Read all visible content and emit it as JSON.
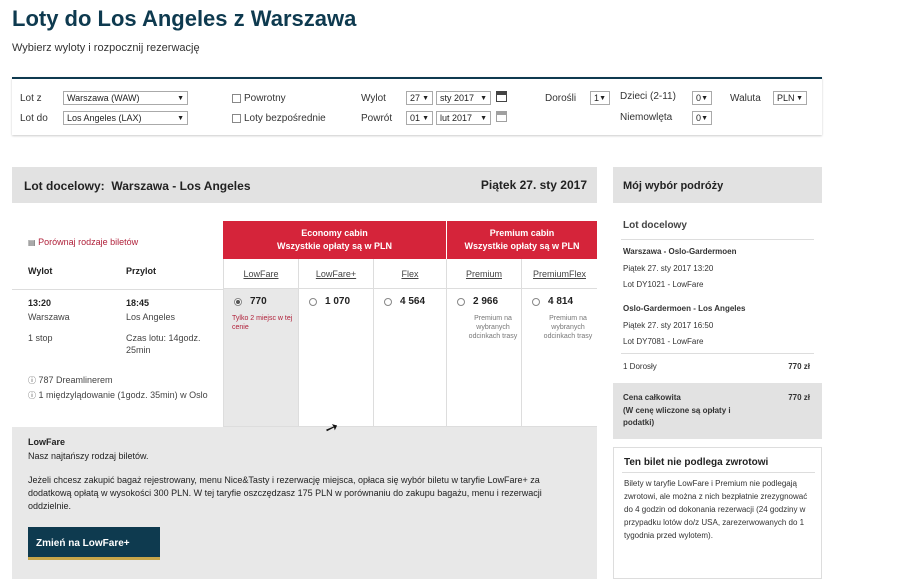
{
  "header": {
    "title": "Loty do Los Angeles z Warszawa",
    "subtitle": "Wybierz wyloty i rozpocznij rezerwację"
  },
  "search": {
    "from_label": "Lot z",
    "from_value": "Warszawa (WAW)",
    "to_label": "Lot do",
    "to_value": "Los Angeles (LAX)",
    "return_label": "Powrotny",
    "direct_label": "Loty bezpośrednie",
    "depart_label": "Wylot",
    "depart_day": "27",
    "depart_month": "sty 2017",
    "return_date_label": "Powrót",
    "return_day": "01",
    "return_month": "lut 2017",
    "adults_label": "Dorośli",
    "adults_value": "1",
    "children_label": "Dzieci (2-11)",
    "children_value": "0",
    "infants_label": "Niemowlęta",
    "infants_value": "0",
    "currency_label": "Waluta",
    "currency_value": "PLN"
  },
  "results": {
    "route_label": "Lot docelowy:",
    "route_value": "Warszawa - Los Angeles",
    "date": "Piątek 27. sty 2017",
    "compare_link": "Porównaj rodzaje biletów",
    "col_depart": "Wylot",
    "col_arrive": "Przylot",
    "cabins": [
      {
        "line1": "Economy cabin",
        "line2": "Wszystkie opłaty są w PLN"
      },
      {
        "line1": "Premium cabin",
        "line2": "Wszystkie opłaty są w PLN"
      }
    ],
    "fares": [
      {
        "name": "LowFare",
        "price": "770",
        "note": "Tylko 2 miejsc w tej cenie",
        "selected": true
      },
      {
        "name": "LowFare+",
        "price": "1 070",
        "note": "",
        "selected": false
      },
      {
        "name": "Flex",
        "price": "4 564",
        "note": "",
        "selected": false
      },
      {
        "name": "Premium",
        "price": "2 966",
        "note": "Premium na wybranych odcinkach trasy",
        "selected": false
      },
      {
        "name": "PremiumFlex",
        "price": "4 814",
        "note": "Premium na wybranych odcinkach trasy",
        "selected": false
      }
    ],
    "flight": {
      "depart_time": "13:20",
      "depart_city": "Warszawa",
      "stops": "1 stop",
      "arrive_time": "18:45",
      "arrive_city": "Los Angeles",
      "duration": "Czas lotu: 14godz. 25min",
      "aircraft": "787 Dreamlinerem",
      "stopover": "1 międzylądowanie (1godz. 35min) w Oslo"
    },
    "fare_desc": {
      "name": "LowFare",
      "short": "Nasz najtańszy rodzaj biletów.",
      "long": "Jeżeli chcesz zakupić bagaż rejestrowany, menu Nice&Tasty i rezerwację miejsca, opłaca się wybór biletu w taryfie LowFare+ za dodatkową opłatą w wysokości 300 PLN. W tej taryfie oszczędzasz 175 PLN w porównaniu do zakupu bagażu, menu i rezerwacji oddzielnie.",
      "button": "Zmień na LowFare+"
    }
  },
  "summary": {
    "title": "Mój wybór podróży",
    "section": "Lot docelowy",
    "leg1_route": "Warszawa - Oslo-Gardermoen",
    "leg1_time": "Piątek 27. sty 2017 13:20",
    "leg1_flight": "Lot DY1021 - LowFare",
    "leg2_route": "Oslo-Gardermoen - Los Angeles",
    "leg2_time": "Piątek 27. sty 2017 16:50",
    "leg2_flight": "Lot DY7081 - LowFare",
    "passengers": "1 Dorosły",
    "passengers_price": "770 zł",
    "total_label": "Cena całkowita",
    "total_note": "(W cenę wliczone są opłaty i podatki)",
    "total_price": "770 zł",
    "refund_title": "Ten bilet nie podlega zwrotowi",
    "refund_text": "Bilety w taryfie LowFare i Premium nie podlegają zwrotowi, ale można z nich bezpłatnie zrezygnować do 4 godzin od dokonania rezerwacji (24 godziny w przypadku lotów do/z USA, zarezerwowanych do 1 tygodnia przed wylotem)."
  },
  "colors": {
    "brand": "#0e3a4f",
    "cabin": "#d5243a",
    "gold": "#c7a64a"
  }
}
